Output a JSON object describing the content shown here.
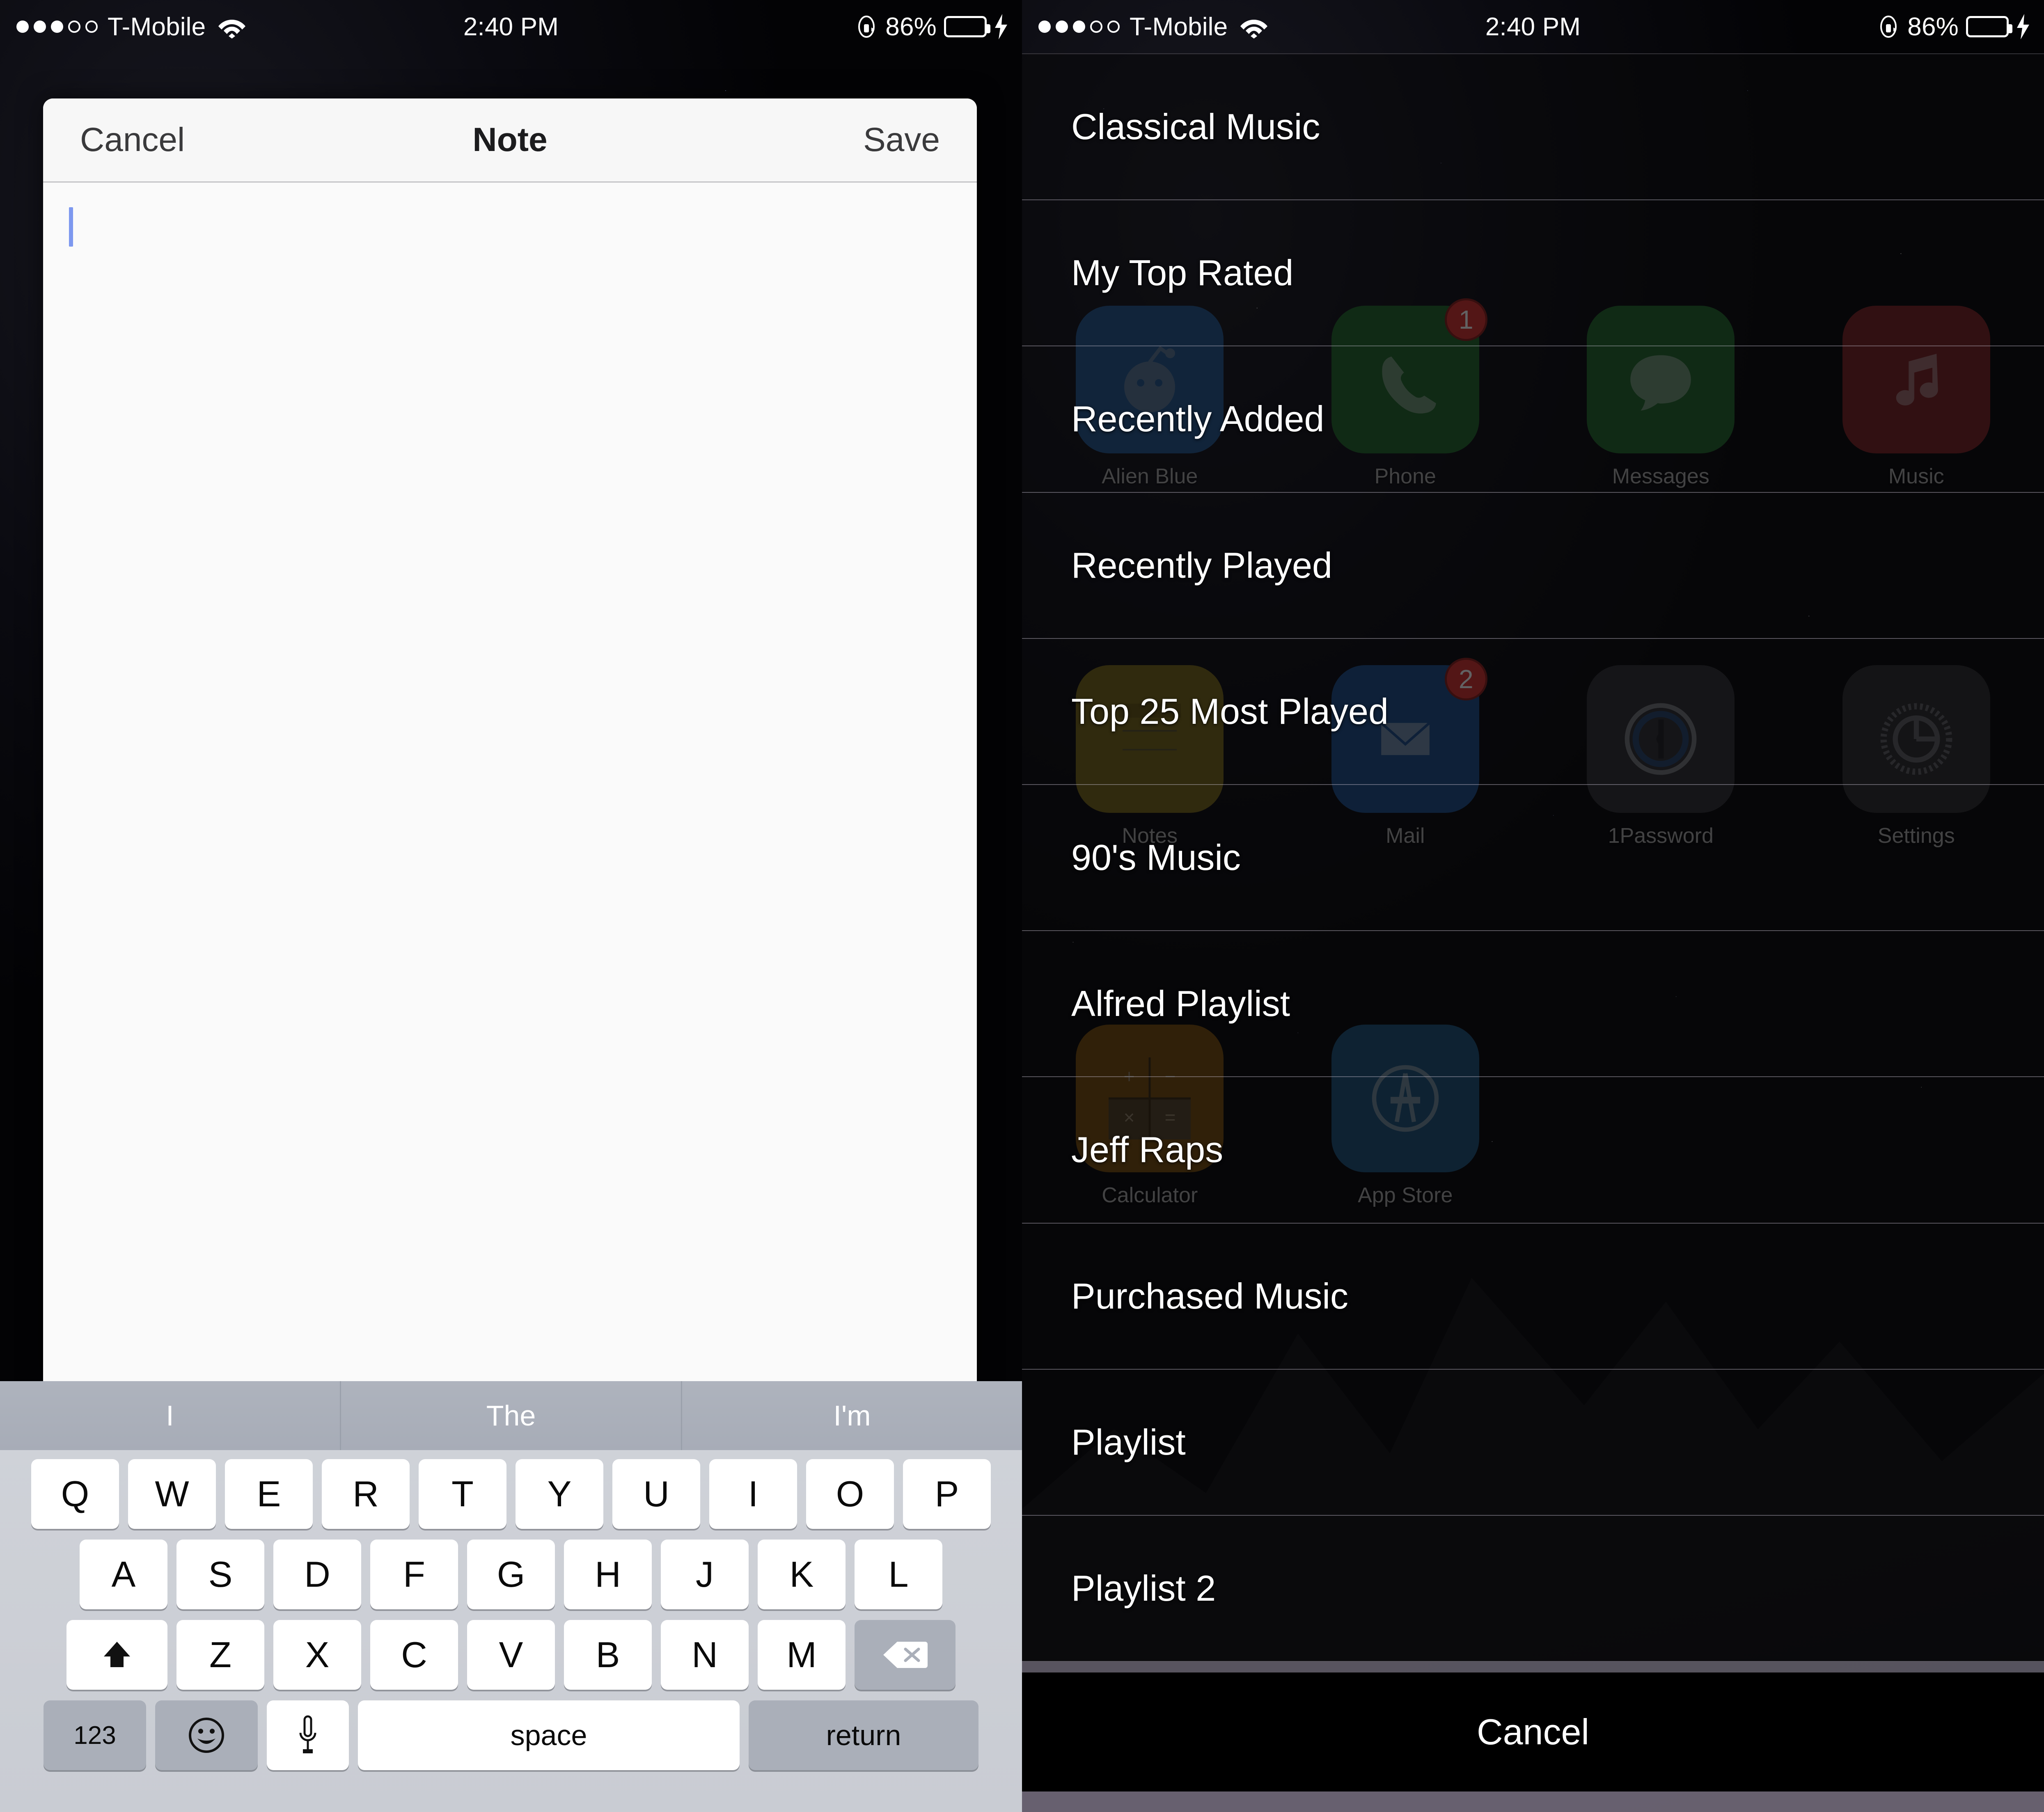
{
  "status_bar": {
    "signal_dots_filled": 3,
    "signal_dots_total": 5,
    "carrier": "T-Mobile",
    "wifi_icon": "wifi-icon",
    "time": "2:40 PM",
    "rotation_lock_icon": "rotation-lock-icon",
    "battery_percent": "86%",
    "battery_level": 86,
    "battery_color": "#4cd964",
    "charging_icon": "lightning-bolt-icon"
  },
  "left_screen": {
    "note_modal": {
      "cancel_label": "Cancel",
      "title": "Note",
      "save_label": "Save",
      "body_text": "",
      "caret_color": "#7d98ef"
    },
    "keyboard": {
      "suggestions": [
        "I",
        "The",
        "I'm"
      ],
      "row1": [
        "Q",
        "W",
        "E",
        "R",
        "T",
        "Y",
        "U",
        "I",
        "O",
        "P"
      ],
      "row2": [
        "A",
        "S",
        "D",
        "F",
        "G",
        "H",
        "J",
        "K",
        "L"
      ],
      "row3_letters": [
        "Z",
        "X",
        "C",
        "V",
        "B",
        "N",
        "M"
      ],
      "shift_icon": "shift-arrow-icon",
      "backspace_icon": "backspace-delete-icon",
      "numbers_label": "123",
      "emoji_icon": "emoji-smiley-icon",
      "dictation_icon": "microphone-icon",
      "space_label": "space",
      "return_label": "return"
    }
  },
  "right_screen": {
    "action_sheet": {
      "playlists": [
        "Classical Music",
        "My Top Rated",
        "Recently Added",
        "Recently Played",
        "Top 25 Most Played",
        "90's Music",
        "Alfred Playlist",
        "Jeff Raps",
        "Purchased Music",
        "Playlist",
        "Playlist 2"
      ],
      "cancel_label": "Cancel"
    },
    "home_screen": {
      "apps": [
        {
          "label": "Alien Blue",
          "icon": "alien-blue-icon",
          "color": "#1f4f82",
          "badge": null
        },
        {
          "label": "Phone",
          "icon": "phone-icon",
          "color": "#1d5c26",
          "badge": "1"
        },
        {
          "label": "Messages",
          "icon": "messages-icon",
          "color": "#1d5c26",
          "badge": null
        },
        {
          "label": "Music",
          "icon": "music-note-icon",
          "color": "#6e1c20",
          "badge": null
        },
        {
          "label": "Notes",
          "icon": "notes-icon",
          "color": "#6b5c15",
          "badge": null
        },
        {
          "label": "Mail",
          "icon": "mail-icon",
          "color": "#17447d",
          "badge": "2"
        },
        {
          "label": "1Password",
          "icon": "1password-icon",
          "color": "#2a2a2d",
          "badge": null
        },
        {
          "label": "Settings",
          "icon": "settings-gear-icon",
          "color": "#262628",
          "badge": null
        },
        {
          "label": "Calculator",
          "icon": "calculator-icon",
          "color": "#6b4508",
          "badge": null
        },
        {
          "label": "App Store",
          "icon": "app-store-icon",
          "color": "#17496e",
          "badge": null
        }
      ]
    }
  }
}
